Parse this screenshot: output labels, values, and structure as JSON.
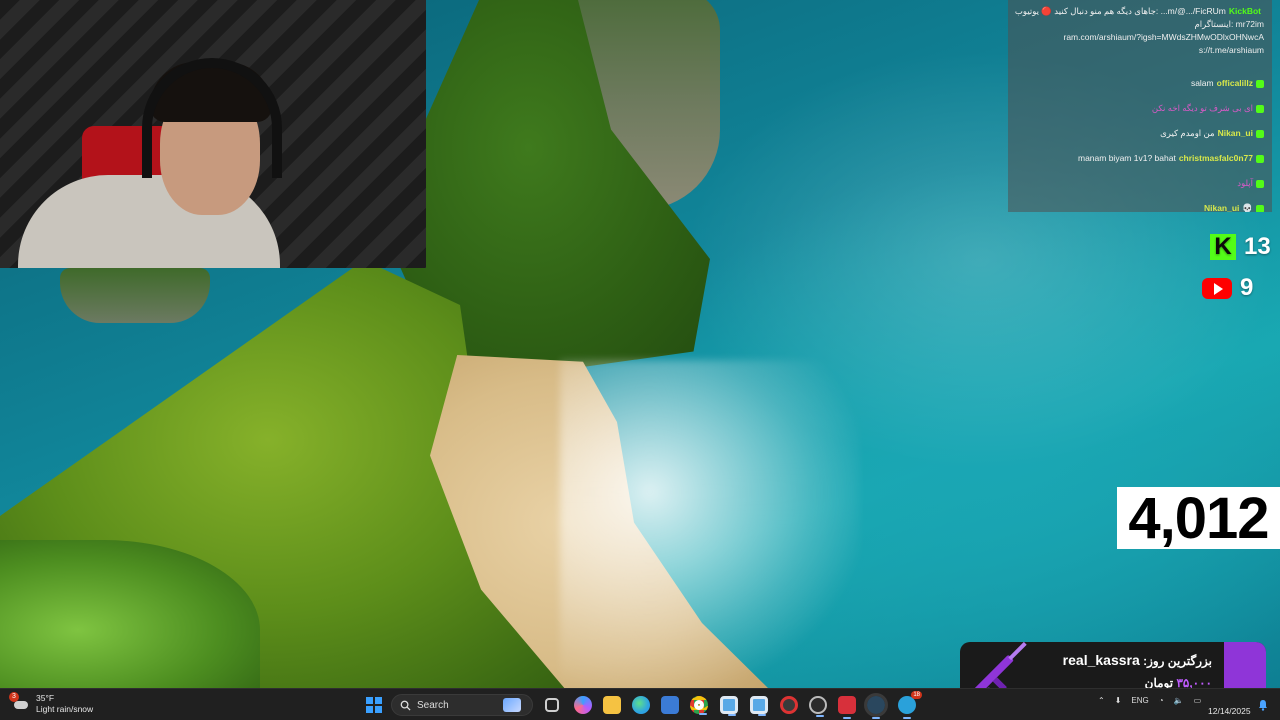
{
  "stream": {
    "chat": {
      "messages": [
        {
          "user": "KickBot",
          "user_color": "#53fc18",
          "badge_color": "#53fc18",
          "text": "جاهای دیگه هم منو دنبال کنید 🔴 یوتیوب: ...m/@.../FicRUm"
        },
        {
          "user": "",
          "user_color": "#ffffff",
          "badge_color": "",
          "text": "اینستاگرام: mr72im"
        },
        {
          "user": "",
          "user_color": "#ffffff",
          "badge_color": "",
          "text": "ram.com/arshiaum/?igsh=MWdsZHMwODlxOHNwcA"
        },
        {
          "user": "",
          "user_color": "#ffffff",
          "badge_color": "",
          "text": "s://t.me/arshiaum"
        },
        {
          "user": "officalillz",
          "user_color": "#d8e84a",
          "badge_color": "#53fc18",
          "text": "salam"
        },
        {
          "user": "",
          "user_color": "#d95ac7",
          "badge_color": "#53fc18",
          "text": "ای بی شرف تو دیگه اخه نکن"
        },
        {
          "user": "Nikan_ui",
          "user_color": "#d8e84a",
          "badge_color": "#53fc18",
          "text": "من اومدم کیری"
        },
        {
          "user": "christmasfalc0n77",
          "user_color": "#d8e84a",
          "badge_color": "#53fc18",
          "text": "manam biyam 1v1? bahat"
        },
        {
          "user": "",
          "user_color": "#d95ac7",
          "badge_color": "#53fc18",
          "text": "آپلود"
        },
        {
          "user": "Nikan_ui",
          "user_color": "#d8e84a",
          "badge_color": "#d0341a",
          "text": "💀"
        }
      ]
    },
    "viewers": {
      "kick_icon": "kick-logo-icon",
      "kick_count": "13",
      "youtube_icon": "youtube-logo-icon",
      "youtube_count": "9",
      "total": "4,012"
    },
    "donation": {
      "label": "بزرگترین روز:",
      "name": "real_kassra",
      "amount": "۳۵,۰۰۰",
      "currency": "تومان",
      "accent_color": "#8f35d8",
      "icon": "rifle-icon"
    }
  },
  "taskbar": {
    "weather": {
      "badge": "3",
      "temp": "35°F",
      "condition": "Light rain/snow"
    },
    "search_placeholder": "Search",
    "apps": [
      {
        "name": "explorer-app",
        "icon": "folder-icon",
        "color": "#f5c242"
      },
      {
        "name": "edge-app",
        "icon": "edge-icon",
        "color": "#2ea3e3"
      },
      {
        "name": "store-app",
        "icon": "store-icon",
        "color": "#3b7bd6"
      },
      {
        "name": "chrome-app",
        "icon": "chrome-icon",
        "color": "#e3b22e"
      },
      {
        "name": "window-app-1",
        "icon": "window-icon",
        "color": "#5aa9e6"
      },
      {
        "name": "window-app-2",
        "icon": "window-icon",
        "color": "#5aa9e6"
      },
      {
        "name": "obs-app",
        "icon": "obs-icon",
        "color": "#3a3a3a"
      },
      {
        "name": "obs-studio-app",
        "icon": "record-icon",
        "color": "#2b2b2b"
      },
      {
        "name": "valorant-app",
        "icon": "valorant-icon",
        "color": "#d7303b"
      },
      {
        "name": "steam-app",
        "icon": "steam-icon",
        "color": "#2a475e"
      },
      {
        "name": "telegram-app",
        "icon": "telegram-icon",
        "color": "#2aa1da",
        "badge": "18"
      }
    ],
    "tray": {
      "language": "ENG"
    },
    "clock": {
      "time": "",
      "date": "12/14/2025"
    }
  }
}
